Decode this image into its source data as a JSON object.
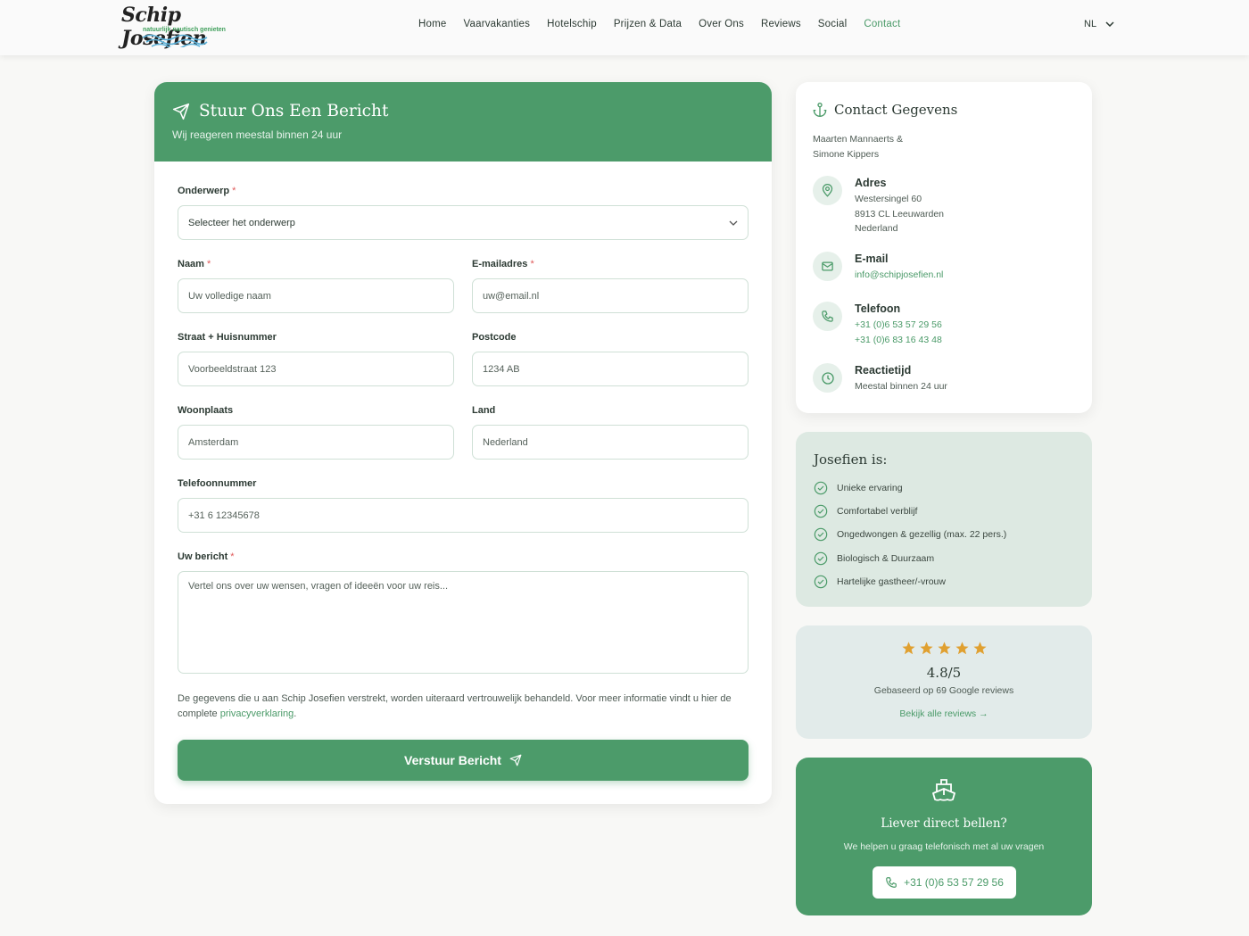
{
  "header": {
    "logo_title": "Schip Josefien",
    "logo_tagline": "natuurlijk nautisch genieten",
    "nav": [
      {
        "label": "Home"
      },
      {
        "label": "Vaarvakanties"
      },
      {
        "label": "Hotelschip"
      },
      {
        "label": "Prijzen & Data"
      },
      {
        "label": "Over Ons"
      },
      {
        "label": "Reviews"
      },
      {
        "label": "Social"
      },
      {
        "label": "Contact",
        "active": true
      }
    ],
    "language": "NL"
  },
  "form": {
    "title": "Stuur Ons Een Bericht",
    "subtitle": "Wij reageren meestal binnen 24 uur",
    "required_mark": "*",
    "subject": {
      "label": "Onderwerp",
      "value": "Selecteer het onderwerp"
    },
    "name": {
      "label": "Naam",
      "placeholder": "Uw volledige naam"
    },
    "email": {
      "label": "E-mailadres",
      "placeholder": "uw@email.nl"
    },
    "street": {
      "label": "Straat + Huisnummer",
      "placeholder": "Voorbeeldstraat 123"
    },
    "postcode": {
      "label": "Postcode",
      "placeholder": "1234 AB"
    },
    "city": {
      "label": "Woonplaats",
      "placeholder": "Amsterdam"
    },
    "country": {
      "label": "Land",
      "placeholder": "Nederland"
    },
    "phone": {
      "label": "Telefoonnummer",
      "placeholder": "+31 6 12345678"
    },
    "message": {
      "label": "Uw bericht",
      "placeholder": "Vertel ons over uw wensen, vragen of ideeën voor uw reis..."
    },
    "privacy_text": "De gegevens die u aan Schip Josefien verstrekt, worden uiteraard vertrouwelijk behandeld. Voor meer informatie vindt u hier de complete ",
    "privacy_link": "privacyverklaring",
    "privacy_end": ".",
    "submit_label": "Verstuur Bericht"
  },
  "contact": {
    "title": "Contact Gegevens",
    "names": "Maarten Mannaerts & Simone Kippers",
    "address": {
      "heading": "Adres",
      "line1": "Westersingel 60",
      "line2": "8913 CL Leeuwarden",
      "line3": "Nederland"
    },
    "email": {
      "heading": "E-mail",
      "value": "info@schipjosefien.nl"
    },
    "phone": {
      "heading": "Telefoon",
      "value1": "+31 (0)6 53 57 29 56",
      "value2": "+31 (0)6 83 16 43 48"
    },
    "response": {
      "heading": "Reactietijd",
      "value": "Meestal binnen 24 uur"
    }
  },
  "features": {
    "title": "Josefien is:",
    "items": [
      {
        "label": "Unieke ervaring"
      },
      {
        "label": "Comfortabel verblijf"
      },
      {
        "label": "Ongedwongen & gezellig (max. 22 pers.)"
      },
      {
        "label": "Biologisch & Duurzaam"
      },
      {
        "label": "Hartelijke gastheer/-vrouw"
      }
    ]
  },
  "reviews": {
    "rating": 5,
    "score": "4.8/5",
    "based_on": "Gebaseerd op 69 Google reviews",
    "link": "Bekijk alle reviews →"
  },
  "call": {
    "title": "Liever direct bellen?",
    "subtitle": "We helpen u graag telefonisch met al uw vragen",
    "phone": "+31 (0)6 53 57 29 56"
  },
  "colors": {
    "accent": "#4c9b6a",
    "accent_text": "#4a9a68",
    "required": "#e05a5a",
    "star": "#e0a030"
  }
}
